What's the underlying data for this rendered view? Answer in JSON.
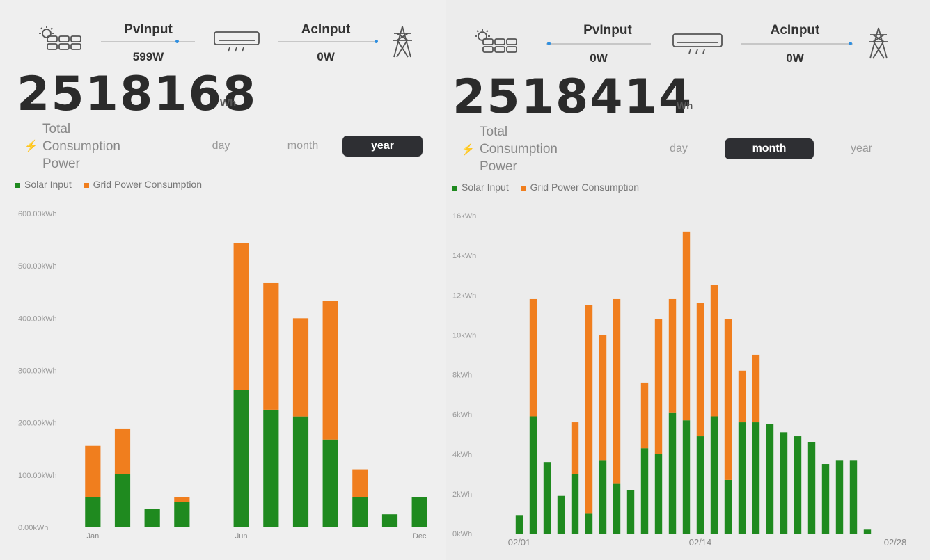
{
  "colors": {
    "solar": "#1f8a1f",
    "grid": "#f07e1e",
    "active_tab_bg": "#2e2f33",
    "dot": "#2f8fe0"
  },
  "left": {
    "pv_label": "PvInput",
    "pv_value": "599W",
    "ac_label": "AcInput",
    "ac_value": "0W",
    "total_value": "2518168",
    "total_unit": "Wh",
    "total_label": [
      "Total",
      "Consumption",
      "Power"
    ],
    "tabs": [
      "day",
      "month",
      "year"
    ],
    "active_tab": "year",
    "legend": {
      "solar": "Solar Input",
      "grid": "Grid Power Consumption"
    }
  },
  "right": {
    "pv_label": "PvInput",
    "pv_value": "0W",
    "ac_label": "AcInput",
    "ac_value": "0W",
    "total_value": "2518414",
    "total_unit": "Wh",
    "total_label": [
      "Total",
      "Consumption",
      "Power"
    ],
    "tabs": [
      "day",
      "month",
      "year"
    ],
    "active_tab": "month",
    "legend": {
      "solar": "Solar Input",
      "grid": "Grid Power Consumption"
    }
  },
  "chart_data": [
    {
      "type": "bar",
      "stacked": true,
      "categories": [
        "Jan",
        "Feb",
        "Mar",
        "Apr",
        "May",
        "Jun",
        "Jul",
        "Aug",
        "Sep",
        "Oct",
        "Nov",
        "Dec"
      ],
      "tick_labels": [
        "Jan",
        "",
        "",
        "",
        "",
        "Jun",
        "",
        "",
        "",
        "",
        "",
        "Dec"
      ],
      "series": [
        {
          "name": "Solar Input",
          "values": [
            58,
            102,
            35,
            48,
            0,
            263,
            225,
            212,
            168,
            58,
            25,
            58
          ]
        },
        {
          "name": "Grid Power Consumption",
          "values": [
            98,
            87,
            0,
            10,
            0,
            281,
            242,
            188,
            265,
            53,
            0,
            0
          ]
        }
      ],
      "y_ticks": [
        "0.00kWh",
        "100.00kWh",
        "200.00kWh",
        "300.00kWh",
        "400.00kWh",
        "500.00kWh",
        "600.00kWh"
      ],
      "ylim": [
        0,
        600
      ],
      "legend_position": "top-left"
    },
    {
      "type": "bar",
      "stacked": true,
      "categories": [
        "02/01",
        "02/02",
        "02/03",
        "02/04",
        "02/05",
        "02/06",
        "02/07",
        "02/08",
        "02/09",
        "02/10",
        "02/11",
        "02/12",
        "02/13",
        "02/14",
        "02/15",
        "02/16",
        "02/17",
        "02/18",
        "02/19",
        "02/20",
        "02/21",
        "02/22",
        "02/23",
        "02/24",
        "02/25",
        "02/26",
        "02/27",
        "02/28"
      ],
      "tick_labels": [
        "02/01",
        "",
        "",
        "",
        "",
        "",
        "",
        "",
        "",
        "",
        "",
        "",
        "",
        "02/14",
        "",
        "",
        "",
        "",
        "",
        "",
        "",
        "",
        "",
        "",
        "",
        "",
        "",
        "02/28"
      ],
      "series": [
        {
          "name": "Solar Input",
          "values": [
            0.9,
            5.9,
            3.6,
            1.9,
            3.0,
            1.0,
            3.7,
            2.5,
            2.2,
            4.3,
            4.0,
            6.1,
            5.7,
            4.9,
            5.9,
            2.7,
            5.6,
            5.6,
            5.5,
            5.1,
            4.9,
            4.6,
            3.5,
            3.7,
            3.7,
            0.2,
            0,
            0
          ]
        },
        {
          "name": "Grid Power Consumption",
          "values": [
            0,
            5.9,
            0,
            0,
            2.6,
            10.5,
            6.3,
            9.3,
            0,
            3.3,
            6.8,
            5.7,
            9.5,
            6.7,
            6.6,
            8.1,
            2.6,
            3.4,
            0,
            0,
            0,
            0,
            0,
            0,
            0,
            0,
            0,
            0
          ]
        }
      ],
      "y_ticks": [
        "0kWh",
        "2kWh",
        "4kWh",
        "6kWh",
        "8kWh",
        "10kWh",
        "12kWh",
        "14kWh",
        "16kWh"
      ],
      "ylim": [
        0,
        16
      ],
      "legend_position": "top-left"
    }
  ]
}
